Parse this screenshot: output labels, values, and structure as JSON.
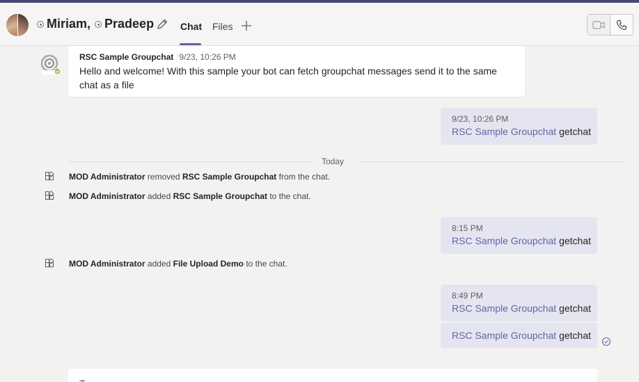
{
  "header": {
    "participants": [
      {
        "name": "Miriam,",
        "presence": "offline"
      },
      {
        "name": "Pradeep",
        "presence": "offline"
      }
    ],
    "tabs": [
      {
        "label": "Chat",
        "active": true
      },
      {
        "label": "Files",
        "active": false
      }
    ],
    "icons": {
      "edit": "pencil-icon",
      "add_tab": "plus-icon",
      "video": "video-camera-icon",
      "audio": "phone-icon"
    },
    "accent_color": "#6264a7"
  },
  "messages": {
    "bot_message": {
      "author": "RSC Sample Groupchat",
      "timestamp": "9/23, 10:26 PM",
      "text": "Hello and welcome! With this sample your bot can fetch groupchat messages send it to the same chat as a file"
    },
    "sent_1": {
      "timestamp": "9/23, 10:26 PM",
      "mention": "RSC Sample Groupchat",
      "text": "getchat"
    },
    "divider_label": "Today",
    "event_1": {
      "actor": "MOD Administrator",
      "verb": "removed",
      "target": "RSC Sample Groupchat",
      "suffix": "from the chat."
    },
    "event_2": {
      "actor": "MOD Administrator",
      "verb": "added",
      "target": "RSC Sample Groupchat",
      "suffix": "to the chat."
    },
    "sent_2": {
      "timestamp": "8:15 PM",
      "mention": "RSC Sample Groupchat",
      "text": "getchat"
    },
    "event_3": {
      "actor": "MOD Administrator",
      "verb": "added",
      "target": "File Upload Demo",
      "suffix": "to the chat."
    },
    "sent_3": {
      "timestamp": "8:49 PM",
      "mention": "RSC Sample Groupchat",
      "text": "getchat"
    },
    "sent_4": {
      "mention": "RSC Sample Groupchat",
      "text": "getchat"
    },
    "status_icon": "seen-check-icon"
  },
  "composer": {
    "text": "T"
  }
}
